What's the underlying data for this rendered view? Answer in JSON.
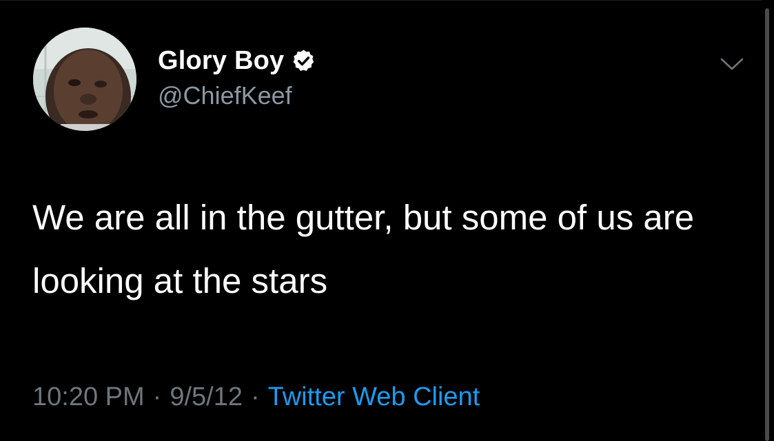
{
  "tweet": {
    "author": {
      "display_name": "Glory Boy",
      "handle": "@ChiefKeef",
      "verified": true,
      "avatar_icon": "profile-photo"
    },
    "text": "We are all in the gutter, but some of us are looking at the stars",
    "time": "10:20 PM",
    "separator": "·",
    "date": "9/5/12",
    "client": "Twitter Web Client",
    "menu_icon": "chevron-down-icon"
  },
  "colors": {
    "background": "#000000",
    "primary_text": "#ffffff",
    "secondary_text": "#6e767d",
    "link": "#1d9bf0",
    "verified_badge": "#ffffff"
  }
}
